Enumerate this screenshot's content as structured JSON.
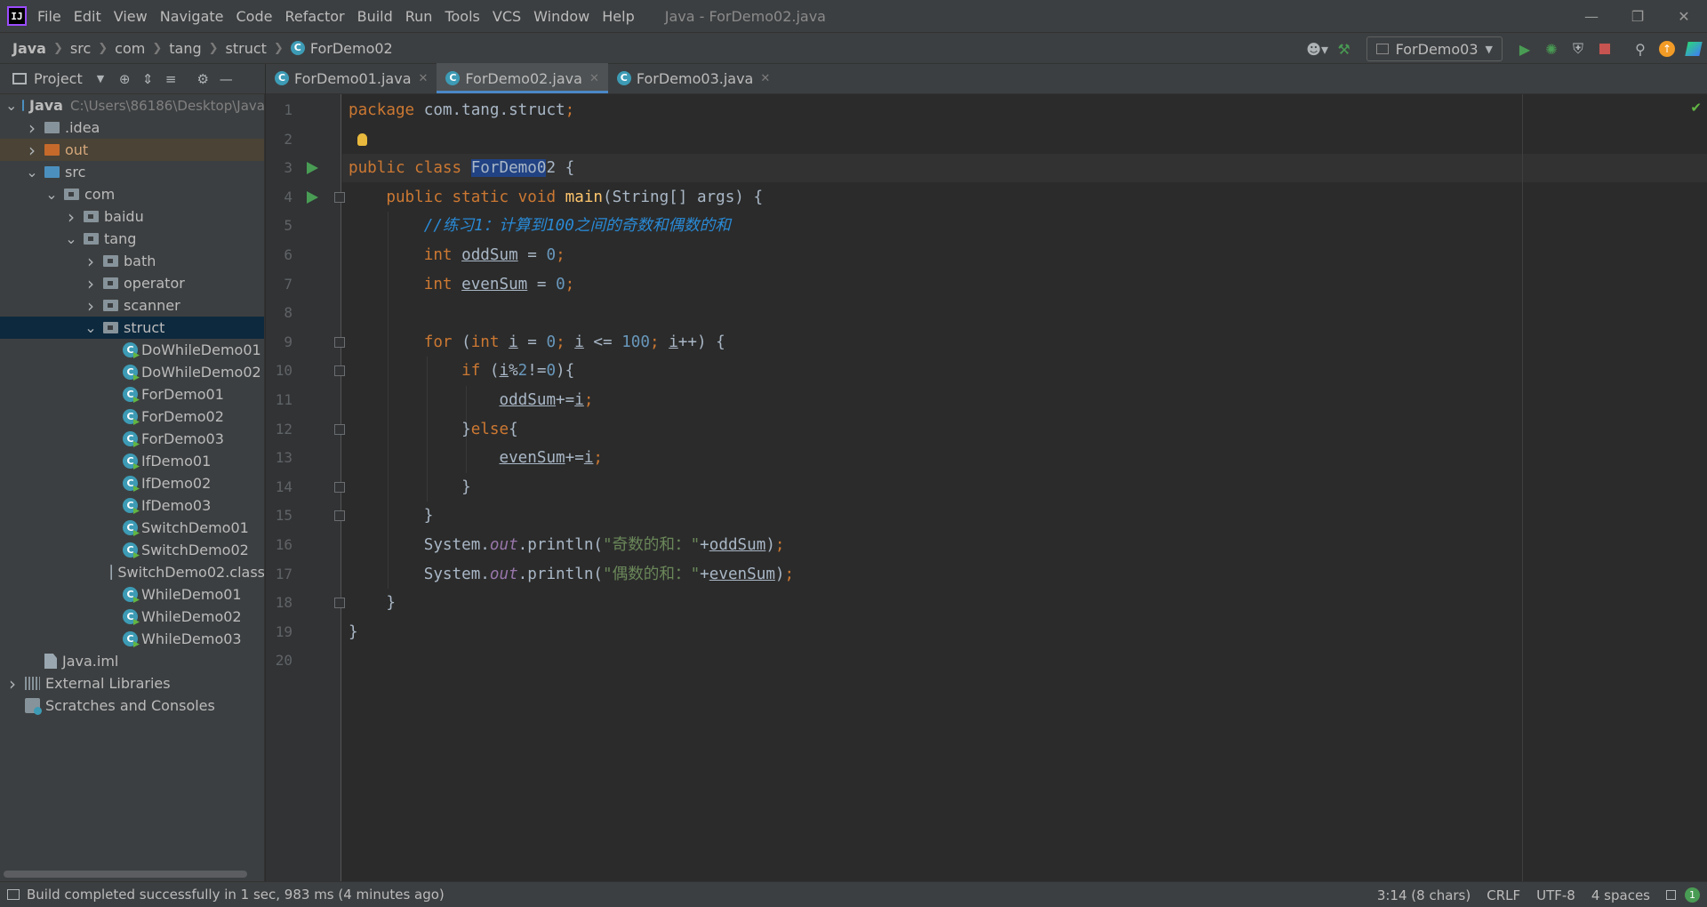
{
  "app": {
    "window_title": "Java - ForDemo02.java",
    "logo": "IJ"
  },
  "menu": [
    "File",
    "Edit",
    "View",
    "Navigate",
    "Code",
    "Refactor",
    "Build",
    "Run",
    "Tools",
    "VCS",
    "Window",
    "Help"
  ],
  "breadcrumb": [
    "Java",
    "src",
    "com",
    "tang",
    "struct",
    "ForDemo02"
  ],
  "run_config": "ForDemo03",
  "project_panel": {
    "title": "Project",
    "tree": [
      {
        "label": "Java",
        "depth": 0,
        "expanded": true,
        "kind": "module",
        "hint": "C:\\Users\\86186\\Desktop\\Java"
      },
      {
        "label": ".idea",
        "depth": 1,
        "expanded": false,
        "kind": "folder"
      },
      {
        "label": "out",
        "depth": 1,
        "expanded": false,
        "kind": "out"
      },
      {
        "label": "src",
        "depth": 1,
        "expanded": true,
        "kind": "src"
      },
      {
        "label": "com",
        "depth": 2,
        "expanded": true,
        "kind": "pkg"
      },
      {
        "label": "baidu",
        "depth": 3,
        "expanded": false,
        "kind": "pkg"
      },
      {
        "label": "tang",
        "depth": 3,
        "expanded": true,
        "kind": "pkg"
      },
      {
        "label": "bath",
        "depth": 4,
        "expanded": false,
        "kind": "pkg"
      },
      {
        "label": "operator",
        "depth": 4,
        "expanded": false,
        "kind": "pkg"
      },
      {
        "label": "scanner",
        "depth": 4,
        "expanded": false,
        "kind": "pkg"
      },
      {
        "label": "struct",
        "depth": 4,
        "expanded": true,
        "kind": "pkg",
        "selected": true
      },
      {
        "label": "DoWhileDemo01",
        "depth": 5,
        "kind": "class"
      },
      {
        "label": "DoWhileDemo02",
        "depth": 5,
        "kind": "class"
      },
      {
        "label": "ForDemo01",
        "depth": 5,
        "kind": "class"
      },
      {
        "label": "ForDemo02",
        "depth": 5,
        "kind": "class"
      },
      {
        "label": "ForDemo03",
        "depth": 5,
        "kind": "class"
      },
      {
        "label": "IfDemo01",
        "depth": 5,
        "kind": "class"
      },
      {
        "label": "IfDemo02",
        "depth": 5,
        "kind": "class"
      },
      {
        "label": "IfDemo03",
        "depth": 5,
        "kind": "class"
      },
      {
        "label": "SwitchDemo01",
        "depth": 5,
        "kind": "class"
      },
      {
        "label": "SwitchDemo02",
        "depth": 5,
        "kind": "class"
      },
      {
        "label": "SwitchDemo02.class",
        "depth": 5,
        "kind": "file"
      },
      {
        "label": "WhileDemo01",
        "depth": 5,
        "kind": "class"
      },
      {
        "label": "WhileDemo02",
        "depth": 5,
        "kind": "class"
      },
      {
        "label": "WhileDemo03",
        "depth": 5,
        "kind": "class"
      },
      {
        "label": "Java.iml",
        "depth": 1,
        "kind": "file"
      },
      {
        "label": "External Libraries",
        "depth": 0,
        "expanded": false,
        "kind": "lib"
      },
      {
        "label": "Scratches and Consoles",
        "depth": 0,
        "kind": "scratch"
      }
    ]
  },
  "tabs": [
    {
      "label": "ForDemo01.java",
      "active": false
    },
    {
      "label": "ForDemo02.java",
      "active": true
    },
    {
      "label": "ForDemo03.java",
      "active": false
    }
  ],
  "editor": {
    "line_count": 20,
    "current_line": 3,
    "run_lines": [
      3,
      4
    ],
    "fold_lines": [
      4,
      9,
      10,
      12,
      14,
      15,
      18
    ],
    "lines": [
      [
        [
          "kw",
          "package "
        ],
        [
          "",
          "com.tang.struct"
        ],
        [
          "kw",
          ";"
        ]
      ],
      [],
      [
        [
          "kw",
          "public class "
        ],
        [
          "hl",
          "ForDemo0"
        ],
        [
          "",
          "2 {"
        ]
      ],
      [
        [
          "",
          "    "
        ],
        [
          "kw",
          "public static void "
        ],
        [
          "fn",
          "main"
        ],
        [
          "",
          "(String[] args) {"
        ]
      ],
      [
        [
          "",
          "        "
        ],
        [
          "cmt",
          "//练习1：计算到100之间的奇数和偶数的和"
        ]
      ],
      [
        [
          "",
          "        "
        ],
        [
          "kw",
          "int "
        ],
        [
          "var",
          "oddSum"
        ],
        [
          "",
          " = "
        ],
        [
          "num",
          "0"
        ],
        [
          "kw",
          ";"
        ]
      ],
      [
        [
          "",
          "        "
        ],
        [
          "kw",
          "int "
        ],
        [
          "var",
          "evenSum"
        ],
        [
          "",
          " = "
        ],
        [
          "num",
          "0"
        ],
        [
          "kw",
          ";"
        ]
      ],
      [],
      [
        [
          "",
          "        "
        ],
        [
          "kw",
          "for "
        ],
        [
          "",
          "("
        ],
        [
          "kw",
          "int "
        ],
        [
          "var",
          "i"
        ],
        [
          "",
          " = "
        ],
        [
          "num",
          "0"
        ],
        [
          "kw",
          "; "
        ],
        [
          "var",
          "i"
        ],
        [
          "",
          " <= "
        ],
        [
          "num",
          "100"
        ],
        [
          "kw",
          "; "
        ],
        [
          "var",
          "i"
        ],
        [
          "",
          "++) {"
        ]
      ],
      [
        [
          "",
          "            "
        ],
        [
          "kw",
          "if "
        ],
        [
          "",
          "("
        ],
        [
          "var",
          "i"
        ],
        [
          "",
          "%"
        ],
        [
          "num",
          "2"
        ],
        [
          "",
          "!="
        ],
        [
          "num",
          "0"
        ],
        [
          "",
          "){"
        ]
      ],
      [
        [
          "",
          "                "
        ],
        [
          "var",
          "oddSum"
        ],
        [
          "",
          "+="
        ],
        [
          "var",
          "i"
        ],
        [
          "kw",
          ";"
        ]
      ],
      [
        [
          "",
          "            }"
        ],
        [
          "kw",
          "else"
        ],
        [
          "",
          "{"
        ]
      ],
      [
        [
          "",
          "                "
        ],
        [
          "var",
          "evenSum"
        ],
        [
          "",
          "+="
        ],
        [
          "var",
          "i"
        ],
        [
          "kw",
          ";"
        ]
      ],
      [
        [
          "",
          "            }"
        ]
      ],
      [
        [
          "",
          "        }"
        ]
      ],
      [
        [
          "",
          "        System."
        ],
        [
          "stat",
          "out"
        ],
        [
          "",
          ".println("
        ],
        [
          "str",
          "\"奇数的和：\""
        ],
        [
          "",
          "+"
        ],
        [
          "var",
          "oddSum"
        ],
        [
          "",
          ")"
        ],
        [
          "kw",
          ";"
        ]
      ],
      [
        [
          "",
          "        System."
        ],
        [
          "stat",
          "out"
        ],
        [
          "",
          ".println("
        ],
        [
          "str",
          "\"偶数的和：\""
        ],
        [
          "",
          "+"
        ],
        [
          "var",
          "evenSum"
        ],
        [
          "",
          ")"
        ],
        [
          "kw",
          ";"
        ]
      ],
      [
        [
          "",
          "    }"
        ]
      ],
      [
        [
          "",
          "}"
        ]
      ],
      []
    ]
  },
  "status": {
    "message": "Build completed successfully in 1 sec, 983 ms (4 minutes ago)",
    "caret": "3:14 (8 chars)",
    "line_sep": "CRLF",
    "encoding": "UTF-8",
    "indent": "4 spaces",
    "notifications": "1"
  }
}
